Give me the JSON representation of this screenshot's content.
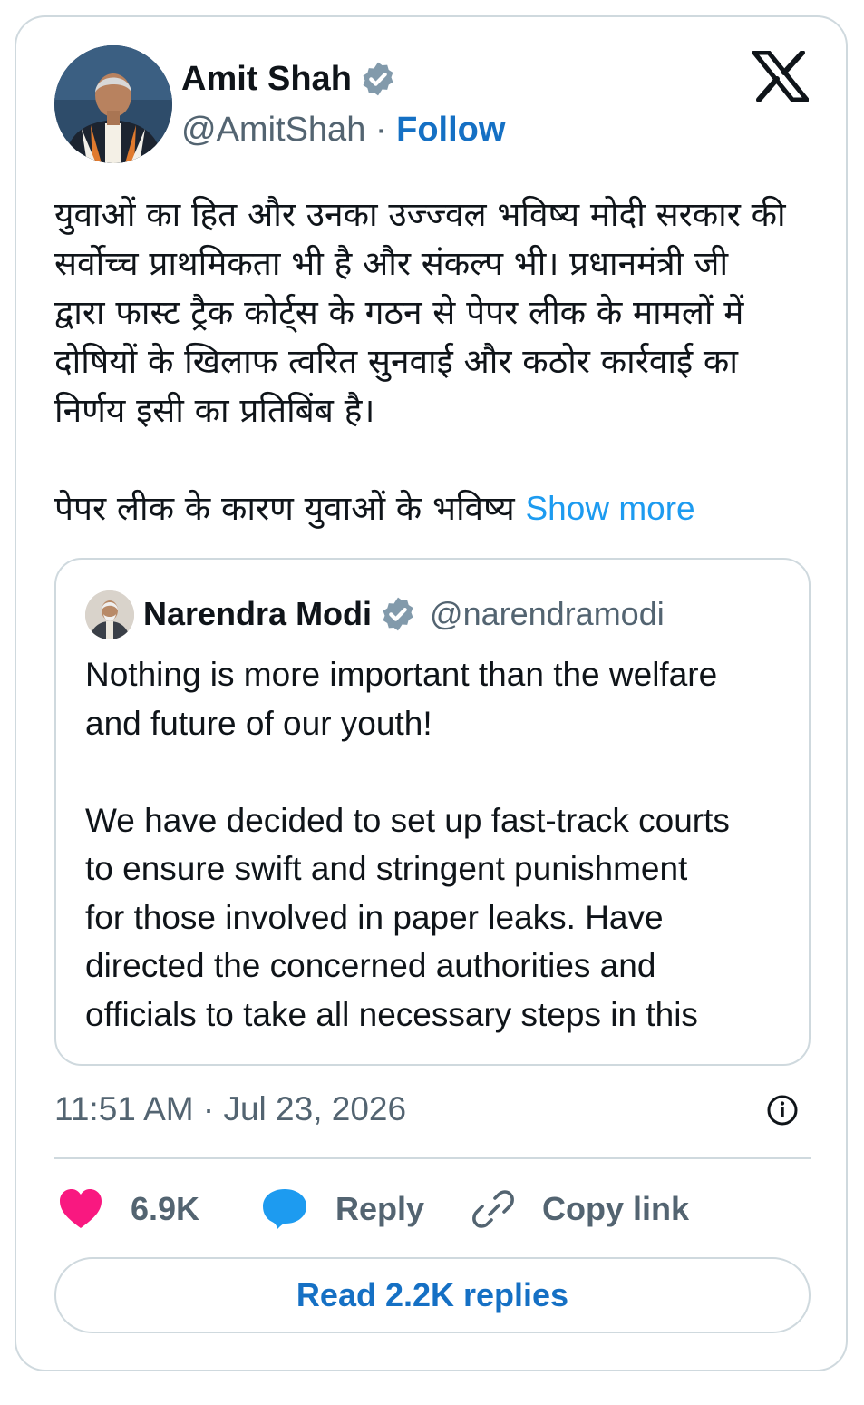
{
  "author": {
    "name": "Amit Shah",
    "handle": "@AmitShah",
    "separator": "·",
    "follow_label": "Follow",
    "verified_icon": "verified-badge-icon"
  },
  "platform_icon": "x-logo-icon",
  "tweet": {
    "paragraph1_lines": [
      "युवाओं का हित और उनका उज्ज्वल भविष्य मोदी सरकार की",
      "सर्वोच्च प्राथमिकता भी है और संकल्प भी। प्रधानमंत्री जी",
      "द्वारा फास्ट ट्रैक कोर्ट्स के गठन से पेपर लीक के मामलों में",
      "दोषियों के खिलाफ त्वरित सुनवाई और कठोर कार्रवाई का",
      "निर्णय इसी का प्रतिबिंब है।"
    ],
    "paragraph2": "पेपर लीक के कारण युवाओं के भविष्य ",
    "show_more_label": "Show more"
  },
  "quoted_tweet": {
    "name": "Narendra Modi",
    "handle": "@narendramodi",
    "lines_part1": [
      "Nothing is more important than the welfare",
      "and future of our youth!"
    ],
    "lines_part2": [
      "We have decided to set up fast-track courts",
      "to ensure swift and stringent punishment",
      "for those involved in paper leaks. Have",
      "directed the concerned authorities and",
      "officials to take all necessary steps in this"
    ]
  },
  "timestamp": "11:51 AM · Jul 23, 2026",
  "actions": {
    "like_count": "6.9K",
    "reply_label": "Reply",
    "copy_link_label": "Copy link"
  },
  "read_replies_label": "Read 2.2K replies",
  "colors": {
    "link_blue": "#1570c4",
    "show_more_blue": "#1d9bf0",
    "heart_pink": "#f91880",
    "reply_blue": "#1d9bf0",
    "secondary_text": "#536471",
    "border": "#cfd9de"
  }
}
